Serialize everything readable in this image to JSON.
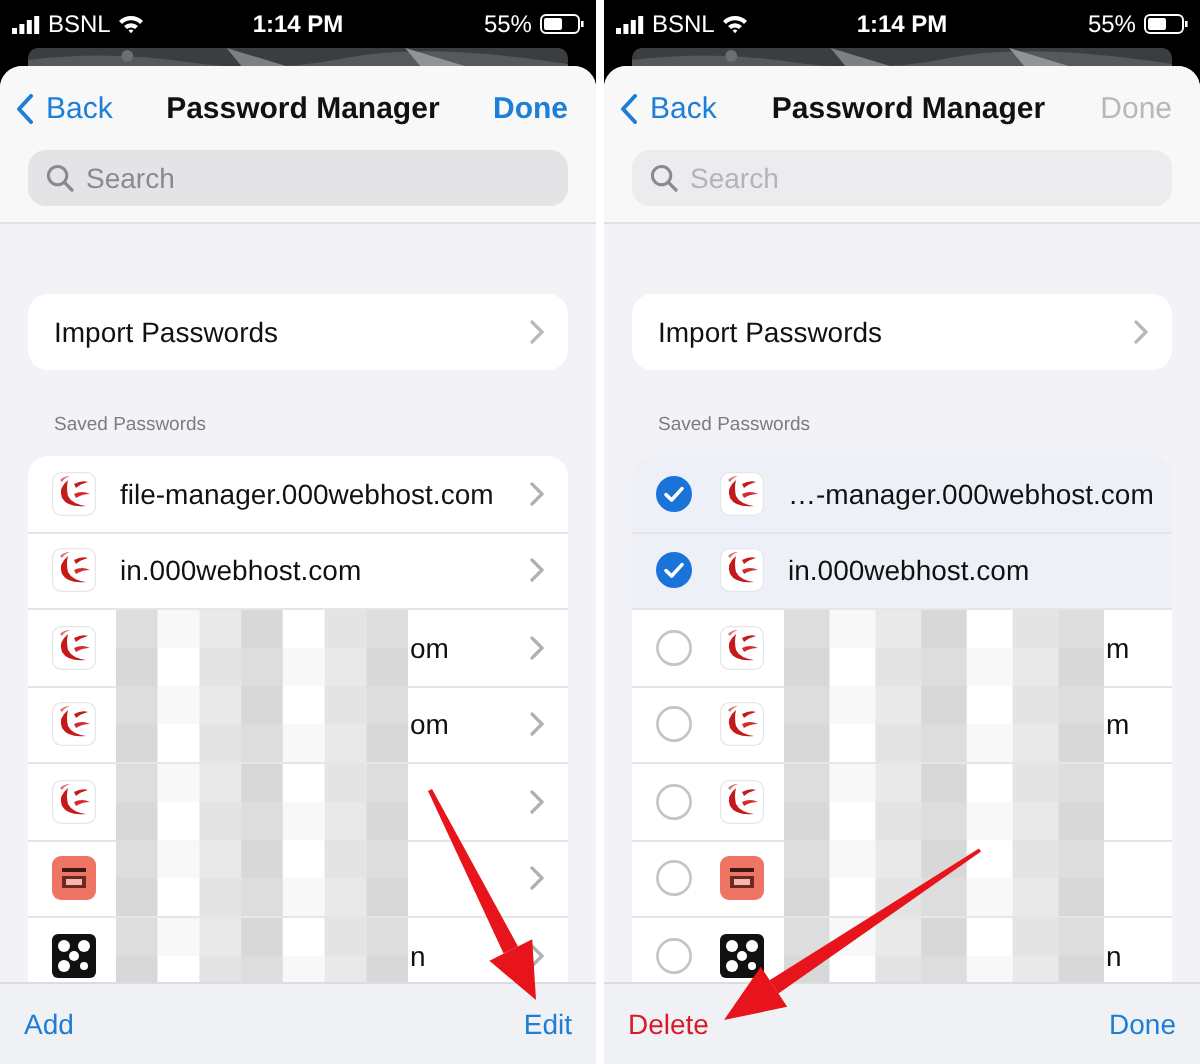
{
  "panels": [
    {
      "status_bar": {
        "carrier": "BSNL",
        "time": "1:14 PM",
        "battery": "55%"
      },
      "nav": {
        "back": "Back",
        "title": "Password Manager",
        "done": {
          "label": "Done",
          "disabled": false
        }
      },
      "search": {
        "placeholder": "Search"
      },
      "import": {
        "label": "Import Passwords"
      },
      "section": "Saved Passwords",
      "editing": false,
      "rows": [
        {
          "kind": "swirl",
          "site": "file-manager.000webhost.com"
        },
        {
          "kind": "swirl",
          "site": "in.000webhost.com"
        },
        {
          "kind": "swirl",
          "fragment": "om"
        },
        {
          "kind": "swirl",
          "fragment": "om"
        },
        {
          "kind": "swirl"
        },
        {
          "kind": "tile"
        },
        {
          "kind": "dots",
          "fragment": "n"
        }
      ],
      "toolbar": [
        {
          "label": "Add",
          "kind": "action"
        },
        {
          "label": "Edit",
          "kind": "action"
        }
      ]
    },
    {
      "status_bar": {
        "carrier": "BSNL",
        "time": "1:14 PM",
        "battery": "55%"
      },
      "nav": {
        "back": "Back",
        "title": "Password Manager",
        "done": {
          "label": "Done",
          "disabled": true
        }
      },
      "search": {
        "placeholder": "Search"
      },
      "import": {
        "label": "Import Passwords"
      },
      "section": "Saved Passwords",
      "editing": true,
      "rows": [
        {
          "kind": "swirl",
          "site": "…-manager.000webhost.com",
          "selected": true
        },
        {
          "kind": "swirl",
          "site": "in.000webhost.com",
          "selected": true
        },
        {
          "kind": "swirl",
          "fragment": "m",
          "selected": false
        },
        {
          "kind": "swirl",
          "fragment": "m",
          "selected": false
        },
        {
          "kind": "swirl",
          "selected": false
        },
        {
          "kind": "tile",
          "selected": false
        },
        {
          "kind": "dots",
          "fragment": "n",
          "selected": false
        }
      ],
      "toolbar": [
        {
          "label": "Delete",
          "kind": "destructive"
        },
        {
          "label": "Done",
          "kind": "action"
        }
      ]
    }
  ]
}
